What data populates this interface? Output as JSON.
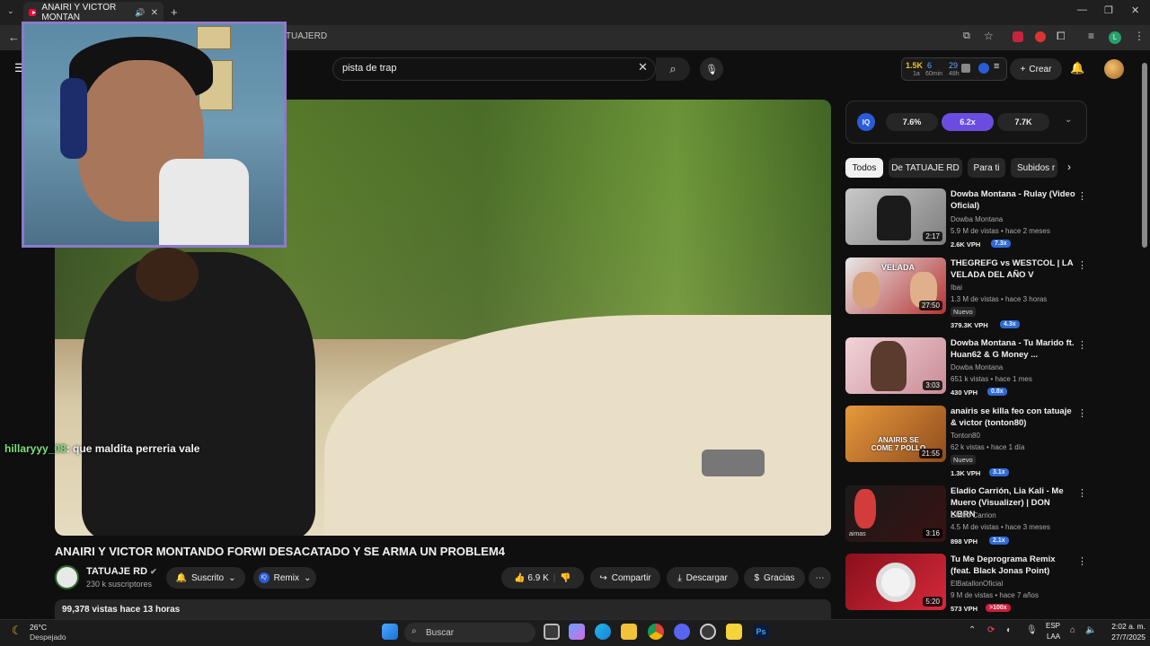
{
  "browser": {
    "tab_title": "ANAIRI Y VICTOR MONTAN",
    "url_fragment": "ATUAJERD"
  },
  "header": {
    "search_value": "pista de trap",
    "create_label": "Crear",
    "stats": {
      "views": "1.5K",
      "views_sub": "1a",
      "n6": "6",
      "n6_sub": "60min",
      "n29": "29",
      "n29_sub": "48h"
    }
  },
  "video": {
    "chat_user": "hillaryyy_08",
    "chat_message": ": que maldita perreria vale",
    "title": "ANAIRI Y VICTOR MONTANDO FORWI DESACATADO Y SE ARMA UN PROBLEM4",
    "channel_name": "TATUAJE RD",
    "channel_subs": "230 k suscriptores",
    "subscribed_label": "Suscrito",
    "remix_label": "Remix",
    "likes": "6.9 K",
    "share_label": "Compartir",
    "download_label": "Descargar",
    "thanks_label": "Gracias",
    "views_line": "99,378 vistas  hace 13 horas"
  },
  "iq": {
    "logo": "IQ",
    "pills": [
      "7.6%",
      "6.2x",
      "7.7K"
    ]
  },
  "chips": [
    "Todos",
    "De TATUAJE RD",
    "Para ti",
    "Subidos r"
  ],
  "recommendations": [
    {
      "title": "Dowba Montana - Rulay (Video Oficial)",
      "channel": "Dowba Montana",
      "meta": "5.9 M de vistas • hace 2 meses",
      "duration": "2:17",
      "vph": "2.6K VPH",
      "badge": "7.3x",
      "new": ""
    },
    {
      "title": "THEGREFG vs WESTCOL | LA VELADA DEL AÑO V",
      "channel": "Ibai",
      "meta": "1.3 M de vistas • hace 3 horas",
      "duration": "27:50",
      "vph": "379.3K VPH",
      "badge": "4.3x",
      "new": "Nuevo"
    },
    {
      "title": "Dowba Montana - Tu Marido ft. Huan62 & G Money ...",
      "channel": "Dowba Montana",
      "meta": "651 k vistas • hace 1 mes",
      "duration": "3:03",
      "vph": "430 VPH",
      "badge": "0.8x",
      "new": ""
    },
    {
      "title": "anairis se killa feo con tatuaje & victor (tonton80)",
      "channel": "Tonton80",
      "meta": "62 k vistas • hace 1 día",
      "duration": "21:55",
      "vph": "1.3K VPH",
      "badge": "3.1x",
      "new": "Nuevo"
    },
    {
      "title": "Eladio Carrión, Lia Kali - Me Muero (Visualizer) | DON KBRN",
      "channel": "Eladio Carrion",
      "meta": "4.5 M de vistas • hace 3 meses",
      "duration": "3:16",
      "vph": "898 VPH",
      "badge": "2.1x",
      "new": ""
    },
    {
      "title": "Tu Me Deprograma Remix (feat. Black Jonas Point)",
      "channel": "ElBatallonOficial",
      "meta": "9 M de vistas • hace 7 años",
      "duration": "5:20",
      "vph": "573 VPH",
      "badge": ">100x",
      "new": ""
    }
  ],
  "thumb_text": {
    "velada": "VELADA",
    "anairis": "ANAIRIS SE COME 7 POLLO",
    "eladio": "aimas"
  },
  "taskbar": {
    "weather_temp": "26°C",
    "weather_desc": "Despejado",
    "search_label": "Buscar",
    "lang": "ESP",
    "lang_sub": "LAA",
    "time": "2:02 a. m.",
    "date": "27/7/2025"
  }
}
